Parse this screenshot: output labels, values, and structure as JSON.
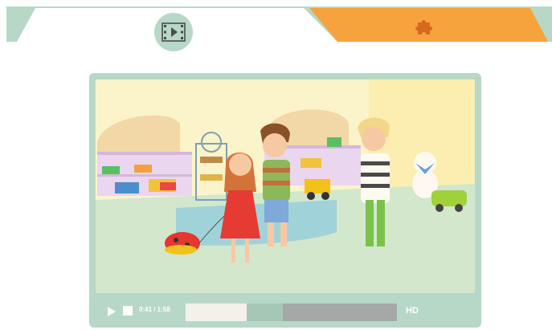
{
  "tabs": [
    {
      "icon": "film-play-icon",
      "selected": true
    },
    {
      "icon": "puzzle-piece-icon",
      "selected": false
    }
  ],
  "colors": {
    "mint": "#b7d8c6",
    "orange": "#f6a33d",
    "background": "#ffffff"
  },
  "player": {
    "time_label": "0:41 / 1:58",
    "progress": 0.29,
    "buffered": 0.46,
    "quality_label": "HD"
  }
}
